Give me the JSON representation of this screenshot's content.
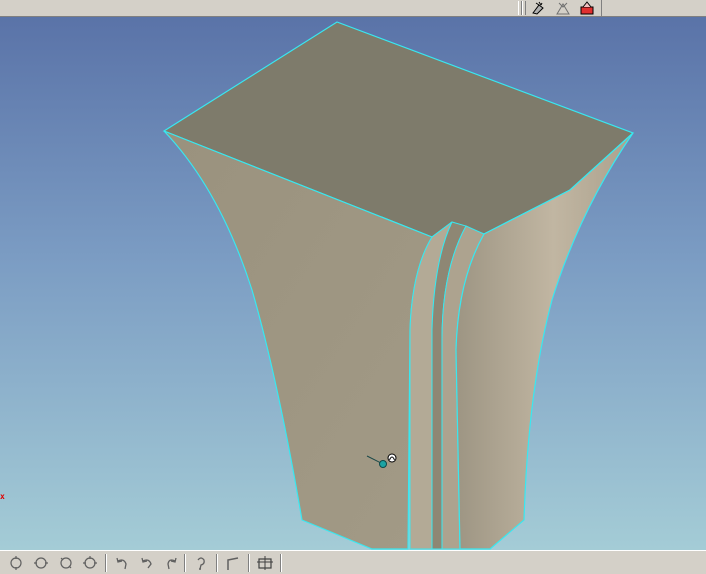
{
  "app": {
    "window": "3D CAD viewport"
  },
  "viewport": {
    "background_top": "#5a73a8",
    "background_bottom": "#a4ccd6",
    "edge_highlight_color": "#38e8f0",
    "triad_axis_label": "x"
  },
  "top_toolbar": {
    "buttons": [
      {
        "icon": "flashlight-render-icon"
      },
      {
        "icon": "triangle-render-icon"
      },
      {
        "icon": "paint-render-icon"
      }
    ]
  },
  "bottom_toolbar": {
    "buttons": [
      {
        "icon": "rotate-view-icon"
      },
      {
        "icon": "rotate-view-icon"
      },
      {
        "icon": "rotate-view-icon"
      },
      {
        "icon": "rotate-view-icon"
      },
      {
        "icon": "undo-icon"
      },
      {
        "icon": "undo-icon"
      },
      {
        "icon": "redo-icon"
      },
      {
        "icon": "refresh-icon"
      },
      {
        "icon": "corner-icon"
      },
      {
        "icon": "fit-icon"
      }
    ]
  }
}
